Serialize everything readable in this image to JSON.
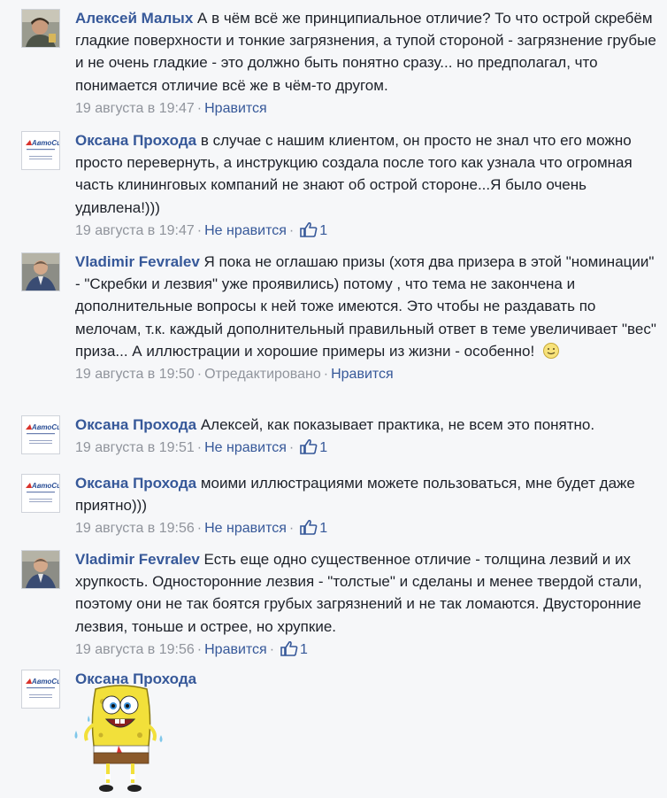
{
  "comments": [
    {
      "author": "Алексей Малых",
      "text": "А в чём всё же принципиальное отличие? То что острой скребём гладкие поверхности и тонкие загрязнения, а тупой стороной - загрязнение грубые и не очень гладкие - это должно быть понятно сразу... но предполагал, что понимается отличие всё же в чём-то другом.",
      "time": "19 августа в 19:47",
      "like_action": "Нравится"
    },
    {
      "author": "Оксана Прохода",
      "text": "в случае с нашим клиентом, он просто не знал что его можно просто перевернуть, а инструкцию создала после того как узнала что огромная часть клининговых компаний не знают об острой стороне...Я было очень удивлена!)))",
      "time": "19 августа в 19:47",
      "like_action": "Не нравится",
      "likes": "1"
    },
    {
      "author": "Vladimir Fevralev",
      "text": "Я пока не оглашаю призы (хотя два призера в этой \"номинации\" - \"Скребки и лезвия\" уже проявились) потому , что тема не закончена и дополнительные вопросы к ней тоже имеются. Это чтобы не раздавать по мелочам, т.к. каждый дополнительный правильный ответ в теме увеличивает \"вес\" приза... А иллюстрации и хорошие примеры из жизни - особенно!",
      "time": "19 августа в 19:50",
      "edited": "Отредактировано",
      "like_action": "Нравится"
    },
    {
      "author": "Оксана Прохода",
      "text": "Алексей, как показывает практика, не всем это понятно.",
      "time": "19 августа в 19:51",
      "like_action": "Не нравится",
      "likes": "1"
    },
    {
      "author": "Оксана Прохода",
      "text": "моими иллюстрациями можете пользоваться, мне будет даже приятно)))",
      "time": "19 августа в 19:56",
      "like_action": "Не нравится",
      "likes": "1"
    },
    {
      "author": "Vladimir Fevralev",
      "text": "Есть еще одно существенное отличие - толщина лезвий и их хрупкость. Односторонние лезвия - \"толстые\" и сделаны и менее твердой стали, поэтому они не так боятся грубых загрязнений и не так ломаются. Двусторонние лезвия, тоньше и острее, но хрупкие.",
      "time": "19 августа в 19:56",
      "like_action": "Нравится",
      "likes": "1"
    },
    {
      "author": "Оксана Прохода"
    }
  ],
  "separator": "·",
  "logo_text": "АвтоСид",
  "colors": {
    "author": "#365899",
    "meta": "#90949c",
    "background": "#f6f7f9"
  }
}
